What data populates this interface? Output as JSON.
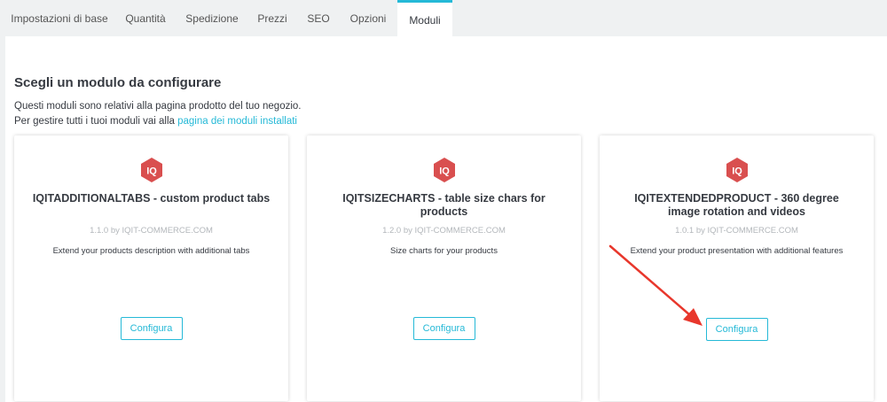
{
  "tabs": [
    {
      "label": "Impostazioni di base"
    },
    {
      "label": "Quantità"
    },
    {
      "label": "Spedizione"
    },
    {
      "label": "Prezzi"
    },
    {
      "label": "SEO"
    },
    {
      "label": "Opzioni"
    },
    {
      "label": "Moduli",
      "active": true
    }
  ],
  "section": {
    "title": "Scegli un modulo da configurare",
    "line1": "Questi moduli sono relativi alla pagina prodotto del tuo negozio.",
    "line2_prefix": "Per gestire tutti i tuoi moduli vai alla",
    "line2_link": "pagina dei moduli installati"
  },
  "modules": [
    {
      "logo": "IQ",
      "name": "IQITADDITIONALTABS - custom product tabs",
      "version": "1.1.0 by IQIT-COMMERCE.COM",
      "description": "Extend your products description with additional tabs",
      "button": "Configura"
    },
    {
      "logo": "IQ",
      "name": "IQITSIZECHARTS - table size chars for products",
      "version": "1.2.0 by IQIT-COMMERCE.COM",
      "description": "Size charts for your products",
      "button": "Configura"
    },
    {
      "logo": "IQ",
      "name": "IQITEXTENDEDPRODUCT - 360 degree image rotation and videos",
      "version": "1.0.1 by IQIT-COMMERCE.COM",
      "description": "Extend your product presentation with additional features",
      "button": "Configura"
    }
  ],
  "colors": {
    "accent": "#25b9d7",
    "logo": "#d94f4f",
    "annotation_arrow": "#e8372c"
  }
}
